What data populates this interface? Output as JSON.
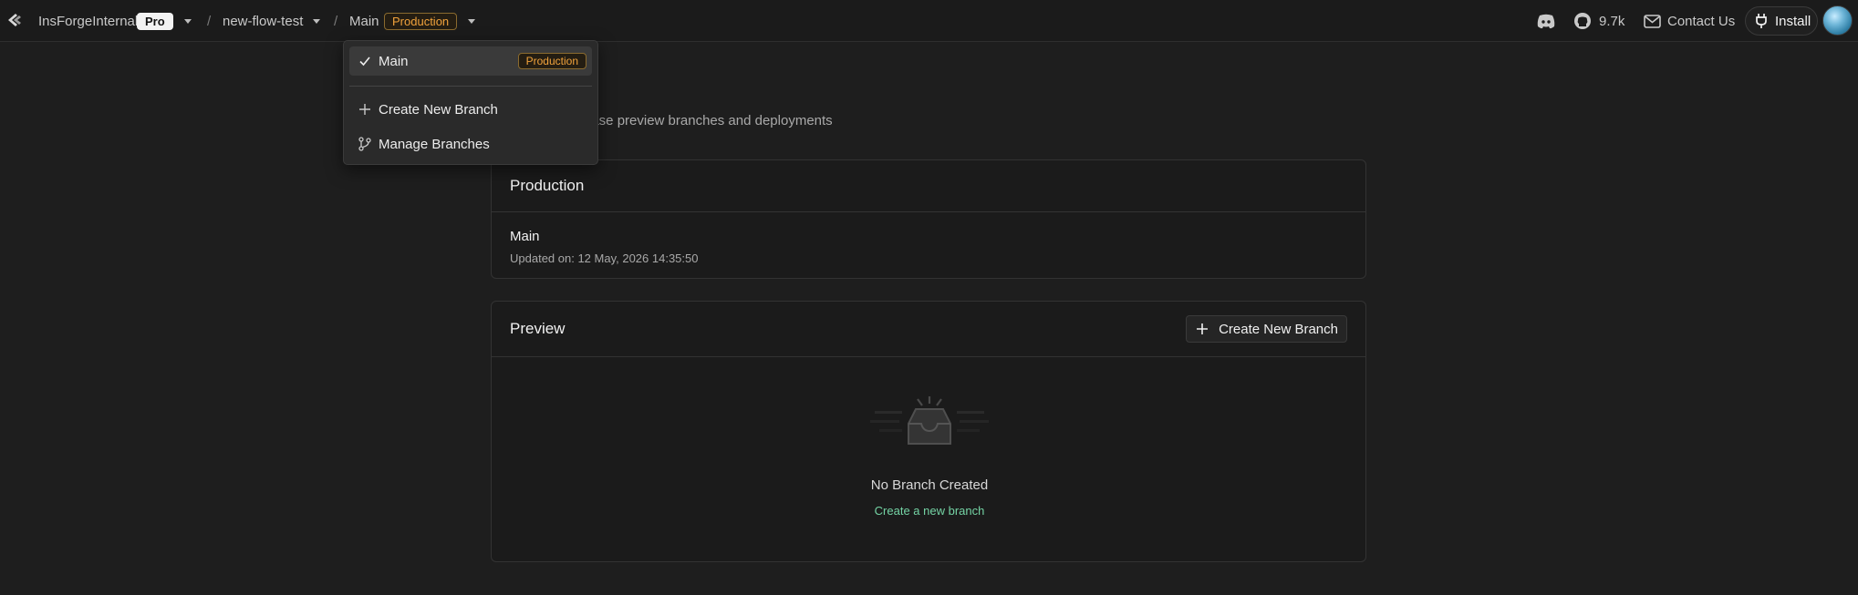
{
  "header": {
    "org_name": "InsForgeInternal",
    "plan_badge": "Pro",
    "project_name": "new-flow-test",
    "branch_name": "Main",
    "branch_badge": "Production",
    "github_stars": "9.7k",
    "contact_label": "Contact Us",
    "install_label": "Install"
  },
  "branch_menu": {
    "selected_label": "Main",
    "selected_badge": "Production",
    "items": [
      {
        "label": "Create New Branch",
        "icon": "plus-icon"
      },
      {
        "label": "Manage Branches",
        "icon": "git-branch-icon"
      }
    ]
  },
  "page": {
    "subtitle_visible": "base preview branches and deployments"
  },
  "production_card": {
    "title": "Production",
    "branch_name": "Main",
    "updated": "Updated on: 12 May, 2026 14:35:50"
  },
  "preview_card": {
    "title": "Preview",
    "create_button_label": "Create New Branch",
    "empty_title": "No Branch Created",
    "empty_link": "Create a new branch"
  },
  "colors": {
    "accent_green": "#74d3a4",
    "production_orange": "#f0a23c",
    "background": "#1e1e1e"
  }
}
